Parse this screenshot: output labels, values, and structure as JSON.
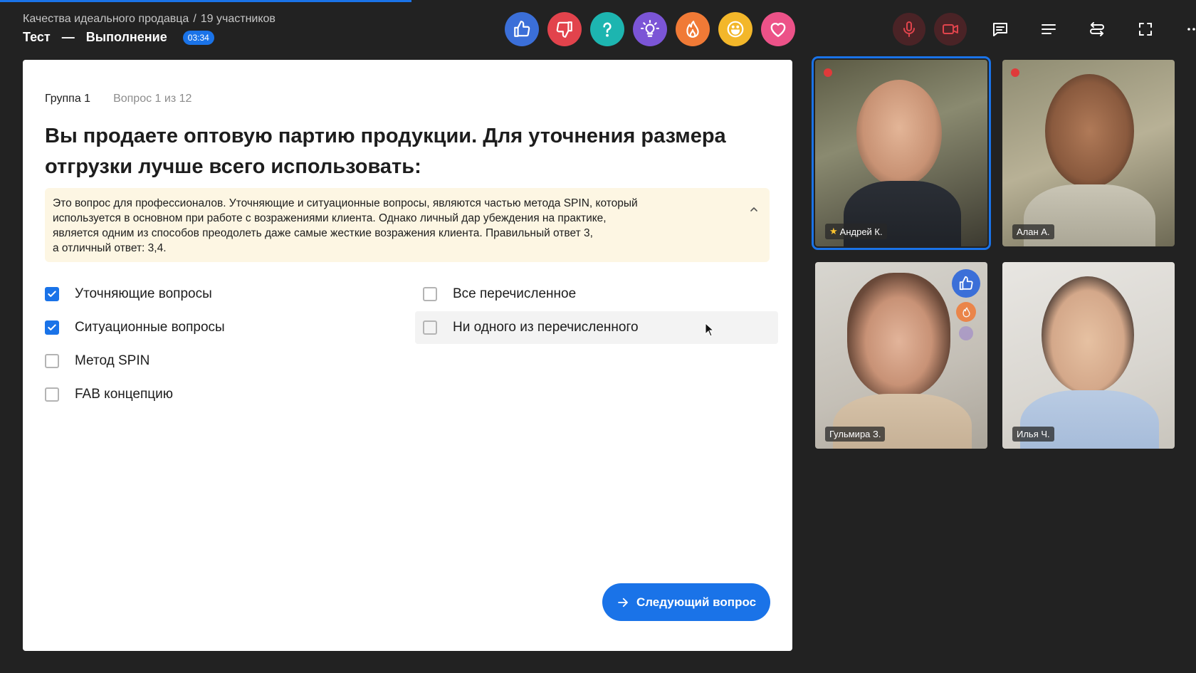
{
  "header": {
    "breadcrumb_course": "Качества идеального продавца",
    "breadcrumb_separator": "/",
    "breadcrumb_participants": "19 участников",
    "title_main": "Тест",
    "title_dash": "—",
    "title_state": "Выполнение",
    "timer": "03:34"
  },
  "progress": {
    "fraction": 0.32,
    "color": "#1a73e8"
  },
  "reactions": [
    {
      "name": "thumbs-up-icon",
      "color": "#3b6fd8"
    },
    {
      "name": "thumbs-down-icon",
      "color": "#e2434c"
    },
    {
      "name": "question-icon",
      "color": "#1db5b0"
    },
    {
      "name": "lightbulb-icon",
      "color": "#7b55d6"
    },
    {
      "name": "fire-icon",
      "color": "#f07a36"
    },
    {
      "name": "smile-icon",
      "color": "#f3b72a"
    },
    {
      "name": "heart-icon",
      "color": "#ec5288"
    }
  ],
  "controls": [
    {
      "name": "microphone-off-icon",
      "state": "off"
    },
    {
      "name": "camera-off-icon",
      "state": "off"
    },
    {
      "name": "chat-icon"
    },
    {
      "name": "list-icon"
    },
    {
      "name": "switch-icon"
    },
    {
      "name": "fullscreen-icon"
    },
    {
      "name": "more-icon"
    }
  ],
  "quiz": {
    "group": "Группа 1",
    "question_number": "Вопрос 1 из 12",
    "question": "Вы продаете оптовую партию продукции. Для уточнения размера отгрузки лучше всего использовать:",
    "hint_line1": "Это вопрос для профессионалов. Уточняющие и ситуационные вопросы, являются частью метода SPIN, который",
    "hint_line2": "используется в основном при работе с возражениями клиента. Однако личный дар убеждения на практике,",
    "hint_line3": "является одним из способов преодолеть даже самые жесткие возражения клиента. Правильный ответ 3,",
    "hint_line4": "а отличный ответ: 3,4.",
    "options": [
      {
        "label": "Уточняющие вопросы",
        "checked": true
      },
      {
        "label": "Ситуационные вопросы",
        "checked": true
      },
      {
        "label": "Метод SPIN",
        "checked": false
      },
      {
        "label": "FAB концепцию",
        "checked": false
      },
      {
        "label": "Все перечисленное",
        "checked": false
      },
      {
        "label": "Ни одного из перечисленного",
        "checked": false
      }
    ],
    "next_button": "Следующий вопрос"
  },
  "participants": [
    {
      "name": "Андрей К.",
      "starred": true,
      "recording": true,
      "active": true
    },
    {
      "name": "Алан А.",
      "starred": false,
      "recording": true,
      "active": false
    },
    {
      "name": "Гульмира З.",
      "starred": false,
      "recording": false,
      "active": false,
      "reactions": [
        "thumbs-up-icon",
        "fire-icon",
        "lightbulb-icon"
      ]
    },
    {
      "name": "Илья Ч.",
      "starred": false,
      "recording": false,
      "active": false
    }
  ],
  "colors": {
    "accent": "#1a73e8",
    "background": "#222222",
    "hint_bg": "#fdf6e3"
  }
}
